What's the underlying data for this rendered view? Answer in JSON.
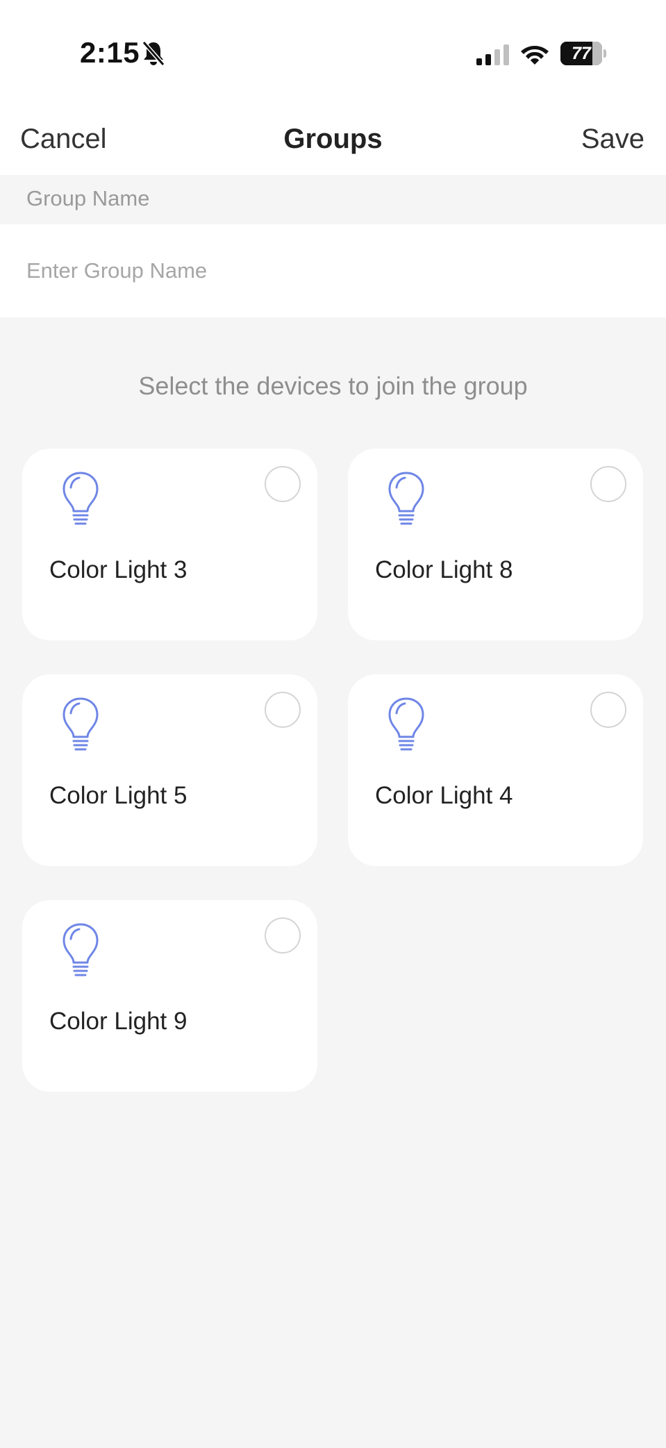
{
  "status_bar": {
    "time": "2:15",
    "battery_level": "77",
    "battery_fraction": 0.77,
    "icons": [
      "bell-slash-icon",
      "cellular-signal-icon",
      "wifi-icon",
      "battery-icon"
    ]
  },
  "nav": {
    "cancel_label": "Cancel",
    "title": "Groups",
    "save_label": "Save"
  },
  "form": {
    "group_name_label": "Group Name",
    "group_name_value": "",
    "group_name_placeholder": "Enter Group Name"
  },
  "devices_hint": "Select the devices to join the group",
  "devices": [
    {
      "name": "Color Light 3",
      "icon": "light-bulb-icon",
      "selected": false
    },
    {
      "name": "Color Light 8",
      "icon": "light-bulb-icon",
      "selected": false
    },
    {
      "name": "Color Light 5",
      "icon": "light-bulb-icon",
      "selected": false
    },
    {
      "name": "Color Light 4",
      "icon": "light-bulb-icon",
      "selected": false
    },
    {
      "name": "Color Light 9",
      "icon": "light-bulb-icon",
      "selected": false
    }
  ],
  "colors": {
    "bulb_stroke": "#6f86e6",
    "background": "#f5f5f5",
    "card": "#ffffff"
  }
}
